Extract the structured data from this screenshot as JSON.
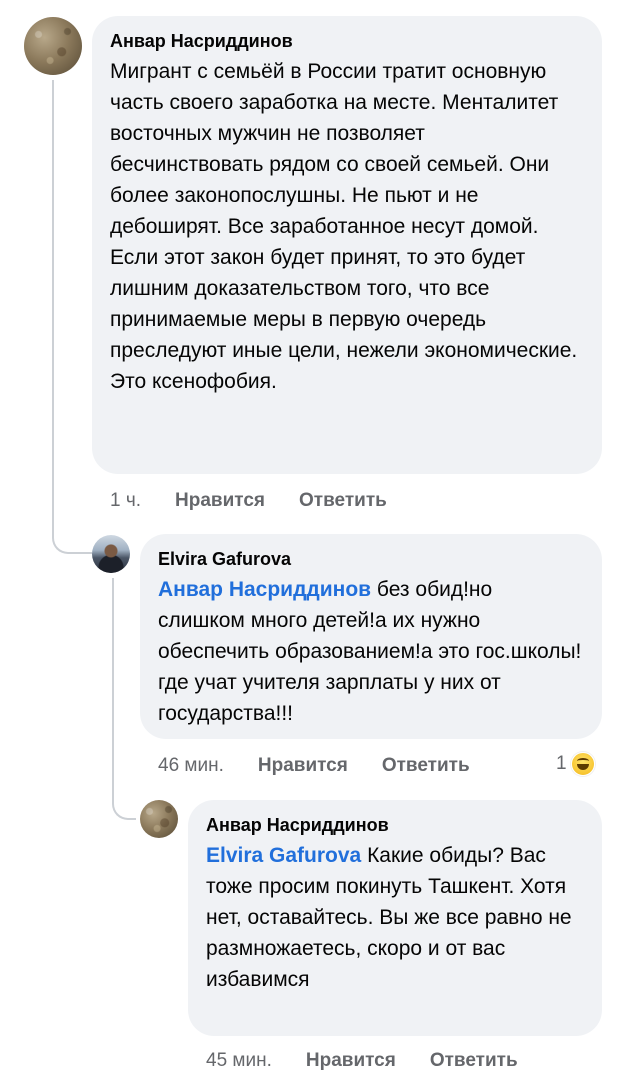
{
  "comments": [
    {
      "author": "Анвар Насриддинов",
      "text": "Мигрант с семьёй в России тратит основную часть своего заработка на месте. Менталитет восточных мужчин не позволяет бесчинствовать рядом со своей семьей. Они более законопослушны. Не пьют и не дебоширят. Все заработанное несут домой. Если этот закон будет принят, то это будет лишним доказательством того, что все принимаемые меры в первую очередь преследуют иные цели, нежели экономические. Это ксенофобия.",
      "time": "1 ч.",
      "like": "Нравится",
      "reply": "Ответить"
    },
    {
      "author": "Elvira Gafurova",
      "mention": "Анвар Насриддинов",
      "text": " без обид!но слишком много детей!а их нужно обеспечить образованием!а это гос.школы!где учат учителя зарплаты у них от государства!!!",
      "time": "46 мин.",
      "like": "Нравится",
      "reply": "Ответить",
      "reaction_count": "1",
      "reaction_icon": "haha-emoji-icon"
    },
    {
      "author": "Анвар Насриддинов",
      "mention": "Elvira Gafurova",
      "text": " Какие обиды? Вас тоже просим покинуть Ташкент. Хотя нет, оставайтесь. Вы же все равно не размножаетесь, скоро и от вас избавимся",
      "time": "45 мин.",
      "like": "Нравится",
      "reply": "Ответить"
    }
  ],
  "colors": {
    "bubble": "#f0f2f5",
    "mention": "#216fdb",
    "meta": "#65676b"
  }
}
